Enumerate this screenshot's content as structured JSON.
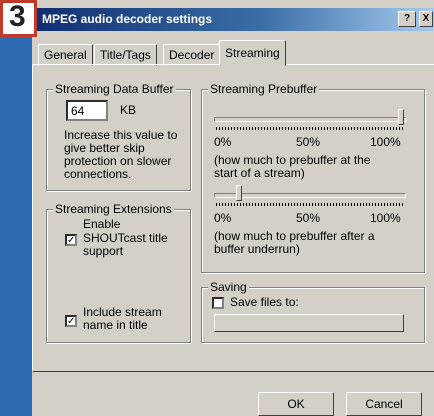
{
  "step_badge": "3",
  "window": {
    "title": "MPEG audio decoder settings",
    "help_button": "?",
    "close_button": "X"
  },
  "tabs": [
    {
      "label": "General"
    },
    {
      "label": "Title/Tags"
    },
    {
      "label": "Decoder"
    },
    {
      "label": "Streaming"
    }
  ],
  "buffer": {
    "legend": "Streaming Data Buffer",
    "value": "64",
    "unit": "KB",
    "desc_lines": [
      "Increase this value to",
      "give better skip",
      "protection on slower",
      "connections."
    ]
  },
  "prebuffer": {
    "legend": "Streaming Prebuffer",
    "slider1": {
      "level": 1.0,
      "labels": [
        "0%",
        "50%",
        "100%"
      ],
      "desc_lines": [
        "(how much to prebuffer at the",
        "start of a stream)"
      ]
    },
    "slider2": {
      "level": 0.12,
      "labels": [
        "0%",
        "50%",
        "100%"
      ],
      "desc_lines": [
        "(how much to prebuffer after a",
        "buffer underrun)"
      ]
    }
  },
  "extensions": {
    "legend": "Streaming Extensions",
    "enable_label": "Enable",
    "shoutcast": {
      "checked": true,
      "lines": [
        "SHOUTcast title",
        "support"
      ]
    },
    "stream_name": {
      "checked": true,
      "lines": [
        "Include stream",
        "name in title"
      ]
    }
  },
  "saving": {
    "legend": "Saving",
    "save_label": "Save files to:",
    "checked": false,
    "path_value": ""
  },
  "buttons": {
    "ok": "OK",
    "cancel": "Cancel"
  }
}
